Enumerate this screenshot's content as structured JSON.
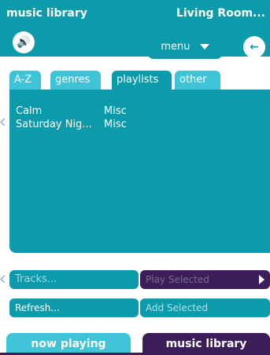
{
  "titlebar": {
    "left_title": "music library",
    "right_title": "Living Room..."
  },
  "toolbar": {
    "speaker_icon": "speaker-icon",
    "menu_label": "menu",
    "back_icon": "back-arrow-icon"
  },
  "tabs": [
    {
      "label": "A-Z",
      "active": false
    },
    {
      "label": "genres",
      "active": false
    },
    {
      "label": "playlists",
      "active": true
    },
    {
      "label": "other",
      "active": false
    }
  ],
  "playlists": [
    {
      "name": "Calm",
      "category": "Misc"
    },
    {
      "name": "Saturday Nig...",
      "category": "Misc"
    }
  ],
  "actions": {
    "tracks_label": "Tracks...",
    "play_selected_label": "Play Selected",
    "refresh_label": "Refresh...",
    "add_selected_label": "Add Selected"
  },
  "bottom_nav": {
    "now_playing_label": "now playing",
    "music_library_label": "music library"
  },
  "colors": {
    "teal": "#0c9bab",
    "light_teal": "#3fc3d6",
    "purple": "#3b1e5a"
  }
}
